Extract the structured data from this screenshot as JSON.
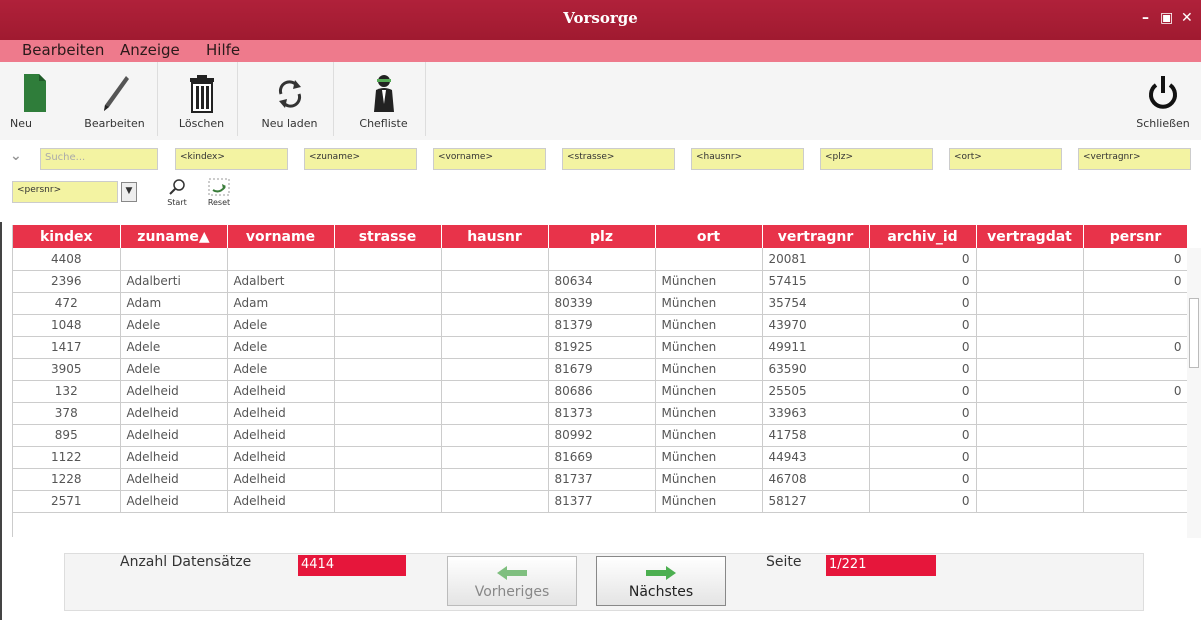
{
  "window": {
    "title": "Vorsorge",
    "controls": [
      "–",
      "▣",
      "✕"
    ]
  },
  "menu": [
    "Bearbeiten",
    "Anzeige",
    "Hilfe"
  ],
  "toolbar": {
    "new": "Neu",
    "edit": "Bearbeiten",
    "delete": "Löschen",
    "reload": "Neu laden",
    "bosslist": "Chefliste",
    "close": "Schließen"
  },
  "filters": {
    "search_placeholder": "Suche...",
    "fields": [
      "<kindex>",
      "<zuname>",
      "<vorname>",
      "<strasse>",
      "<hausnr>",
      "<plz>",
      "<ort>",
      "<vertragnr>"
    ],
    "persnr": "<persnr>",
    "start": "Start",
    "reset": "Reset"
  },
  "table": {
    "columns": [
      "kindex",
      "zuname▲",
      "vorname",
      "strasse",
      "hausnr",
      "plz",
      "ort",
      "vertragnr",
      "archiv_id",
      "vertragdat",
      "persnr"
    ],
    "rows": [
      [
        "4408",
        "",
        "",
        "",
        "",
        "",
        "",
        "20081",
        "0",
        "",
        "0"
      ],
      [
        "2396",
        "Adalberti",
        "Adalbert",
        "",
        "",
        "80634",
        "München",
        "57415",
        "0",
        "",
        "0"
      ],
      [
        "472",
        "Adam",
        "Adam",
        "",
        "",
        "80339",
        "München",
        "35754",
        "0",
        "",
        ""
      ],
      [
        "1048",
        "Adele",
        "Adele",
        "",
        "",
        "81379",
        "München",
        "43970",
        "0",
        "",
        ""
      ],
      [
        "1417",
        "Adele",
        "Adele",
        "",
        "",
        "81925",
        "München",
        "49911",
        "0",
        "",
        "0"
      ],
      [
        "3905",
        "Adele",
        "Adele",
        "",
        "",
        "81679",
        "München",
        "63590",
        "0",
        "",
        ""
      ],
      [
        "132",
        "Adelheid",
        "Adelheid",
        "",
        "",
        "80686",
        "München",
        "25505",
        "0",
        "",
        "0"
      ],
      [
        "378",
        "Adelheid",
        "Adelheid",
        "",
        "",
        "81373",
        "München",
        "33963",
        "0",
        "",
        ""
      ],
      [
        "895",
        "Adelheid",
        "Adelheid",
        "",
        "",
        "80992",
        "München",
        "41758",
        "0",
        "",
        ""
      ],
      [
        "1122",
        "Adelheid",
        "Adelheid",
        "",
        "",
        "81669",
        "München",
        "44943",
        "0",
        "",
        ""
      ],
      [
        "1228",
        "Adelheid",
        "Adelheid",
        "",
        "",
        "81737",
        "München",
        "46708",
        "0",
        "",
        ""
      ],
      [
        "2571",
        "Adelheid",
        "Adelheid",
        "",
        "",
        "81377",
        "München",
        "58127",
        "0",
        "",
        ""
      ]
    ]
  },
  "footer": {
    "count_label": "Anzahl Datensätze",
    "count_value": "4414",
    "prev": "Vorheriges",
    "next": "Nächstes",
    "page_label": "Seite",
    "page_value": "1/221"
  },
  "colors": {
    "title": "#a81c33",
    "menu": "#ee7a8c",
    "header": "#e8334a",
    "field": "#f3f3a2",
    "badge": "#e6163b",
    "arrow": "#4caf50"
  }
}
